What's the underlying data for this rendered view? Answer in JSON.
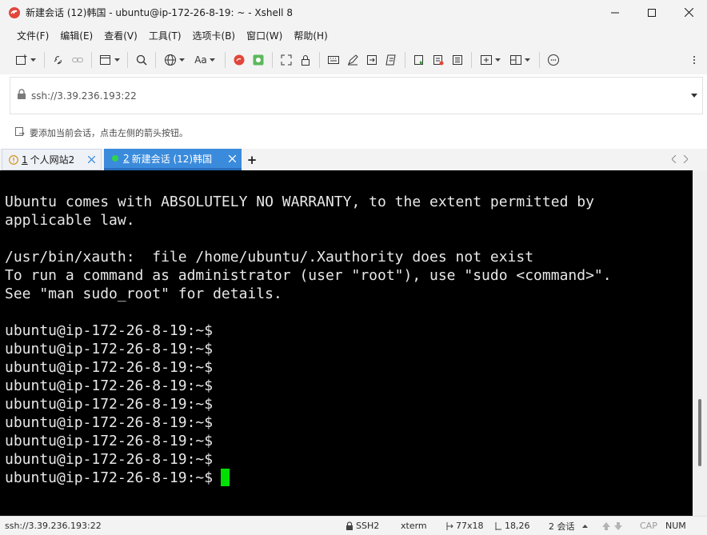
{
  "window": {
    "title": "新建会话 (12)韩国 - ubuntu@ip-172-26-8-19: ~ - Xshell 8",
    "controls": [
      "minimize",
      "maximize",
      "close"
    ]
  },
  "menu": [
    {
      "label": "文件(F)"
    },
    {
      "label": "编辑(E)"
    },
    {
      "label": "查看(V)"
    },
    {
      "label": "工具(T)"
    },
    {
      "label": "选项卡(B)"
    },
    {
      "label": "窗口(W)"
    },
    {
      "label": "帮助(H)"
    }
  ],
  "toolbar": {
    "font_button_label": "Aa",
    "icons": [
      "new-session-icon",
      "disconnect-icon",
      "link-icon",
      "session-manager-icon",
      "search-icon",
      "globe-icon",
      "font-icon",
      "xftp-icon",
      "xagent-icon",
      "fullscreen-icon",
      "lock-icon",
      "keyboard-icon",
      "compose-icon",
      "transfer-icon",
      "script-icon",
      "macro-icon",
      "log-icon",
      "split-icon",
      "layout-icon",
      "chat-icon"
    ]
  },
  "address": {
    "value": "ssh://3.39.236.193:22"
  },
  "hint": {
    "text": "要添加当前会话，点击左侧的箭头按钮。"
  },
  "tabs": [
    {
      "number": "1",
      "label": "个人网站2",
      "active": false,
      "status": "info"
    },
    {
      "number": "2",
      "label": "新建会话 (12)韩国",
      "active": true,
      "status": "connected"
    }
  ],
  "terminal": {
    "lines": [
      "Ubuntu comes with ABSOLUTELY NO WARRANTY, to the extent permitted by",
      "applicable law.",
      "",
      "/usr/bin/xauth:  file /home/ubuntu/.Xauthority does not exist",
      "To run a command as administrator (user \"root\"), use \"sudo <command>\".",
      "See \"man sudo_root\" for details.",
      "",
      "ubuntu@ip-172-26-8-19:~$",
      "ubuntu@ip-172-26-8-19:~$",
      "ubuntu@ip-172-26-8-19:~$",
      "ubuntu@ip-172-26-8-19:~$",
      "ubuntu@ip-172-26-8-19:~$",
      "ubuntu@ip-172-26-8-19:~$",
      "ubuntu@ip-172-26-8-19:~$",
      "ubuntu@ip-172-26-8-19:~$",
      "ubuntu@ip-172-26-8-19:~$"
    ],
    "prompt": "ubuntu@ip-172-26-8-19:~$",
    "cursor_color": "#00e000",
    "text_color": "#e8e8e8",
    "background": "#000000"
  },
  "status": {
    "connection": "ssh://3.39.236.193:22",
    "protocol": "SSH2",
    "terminal_type": "xterm",
    "size": "77x18",
    "cursor_pos": "18,26",
    "sessions": "2 会话",
    "caps": "CAP",
    "num": "NUM"
  },
  "colors": {
    "active_tab": "#3b8bdc",
    "chrome": "#f3f3f3"
  }
}
